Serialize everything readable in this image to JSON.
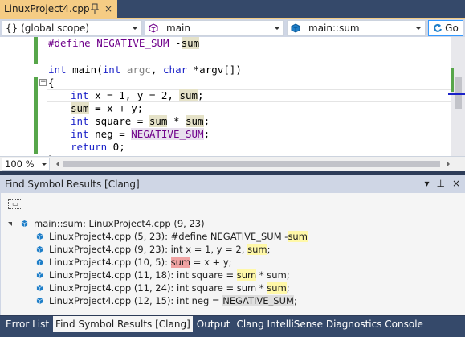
{
  "document_tab": {
    "title": "LinuxProject4.cpp",
    "pin_icon": "pin-icon",
    "close_label": "×"
  },
  "navbar": {
    "scope": "{} (global scope)",
    "function": "main",
    "member": "main::sum",
    "go_label": "Go"
  },
  "code": {
    "line1": {
      "pre": "#define ",
      "macro": "NEGATIVE_SUM",
      "post": " -",
      "hl": "sum"
    },
    "line2": {
      "kw": "int",
      "post": " main(",
      "kw2": "int",
      "p1": " argc",
      "c": ", ",
      "kw3": "char",
      "p2": " *argv",
      "end": "[])"
    },
    "line3": "{",
    "line4": {
      "kw": "int",
      "mid": " x = 1, y = 2, ",
      "hl": "sum",
      "end": ";"
    },
    "line5": {
      "hl": "sum",
      "end": " = x + y;"
    },
    "line6": {
      "kw": "int",
      "mid": " square = ",
      "hl1": "sum",
      "op": " * ",
      "hl2": "sum",
      "end": ";"
    },
    "line7": {
      "kw": "int",
      "mid": " neg = ",
      "hl": "NEGATIVE_SUM",
      "end": ";"
    },
    "line8": {
      "kw": "return",
      "end": " 0;"
    },
    "line9": "}"
  },
  "zoom": "100 %",
  "tool_window": {
    "title": "Find Symbol Results [Clang]",
    "dropdown_icon": "▾",
    "pin_icon": "⊥",
    "close_icon": "×",
    "root": "main::sum: LinuxProject4.cpp (9, 23)",
    "results": [
      {
        "loc": "LinuxProject4.cpp (5, 23): ",
        "pre": "#define NEGATIVE_SUM -",
        "hl": "sum",
        "post": "",
        "kind": "y"
      },
      {
        "loc": "LinuxProject4.cpp (9, 23): ",
        "pre": "int x = 1, y = 2, ",
        "hl": "sum",
        "post": ";",
        "kind": "y"
      },
      {
        "loc": "LinuxProject4.cpp (10, 5): ",
        "pre": "",
        "hl": "sum",
        "post": " = x + y;",
        "kind": "r"
      },
      {
        "loc": "LinuxProject4.cpp (11, 18): ",
        "pre": "int square = ",
        "hl": "sum",
        "post": " * sum;",
        "kind": "y"
      },
      {
        "loc": "LinuxProject4.cpp (11, 24): ",
        "pre": "int square = sum * ",
        "hl": "sum",
        "post": ";",
        "kind": "y"
      },
      {
        "loc": "LinuxProject4.cpp (12, 15): ",
        "pre": "int neg = ",
        "hl": "NEGATIVE_SUM",
        "post": ";",
        "kind": "g"
      }
    ]
  },
  "bottom_tabs": [
    {
      "label": "Error List",
      "active": false
    },
    {
      "label": "Find Symbol Results [Clang]",
      "active": true
    },
    {
      "label": "Output",
      "active": false
    },
    {
      "label": "Clang IntelliSense Diagnostics Console",
      "active": false
    }
  ]
}
